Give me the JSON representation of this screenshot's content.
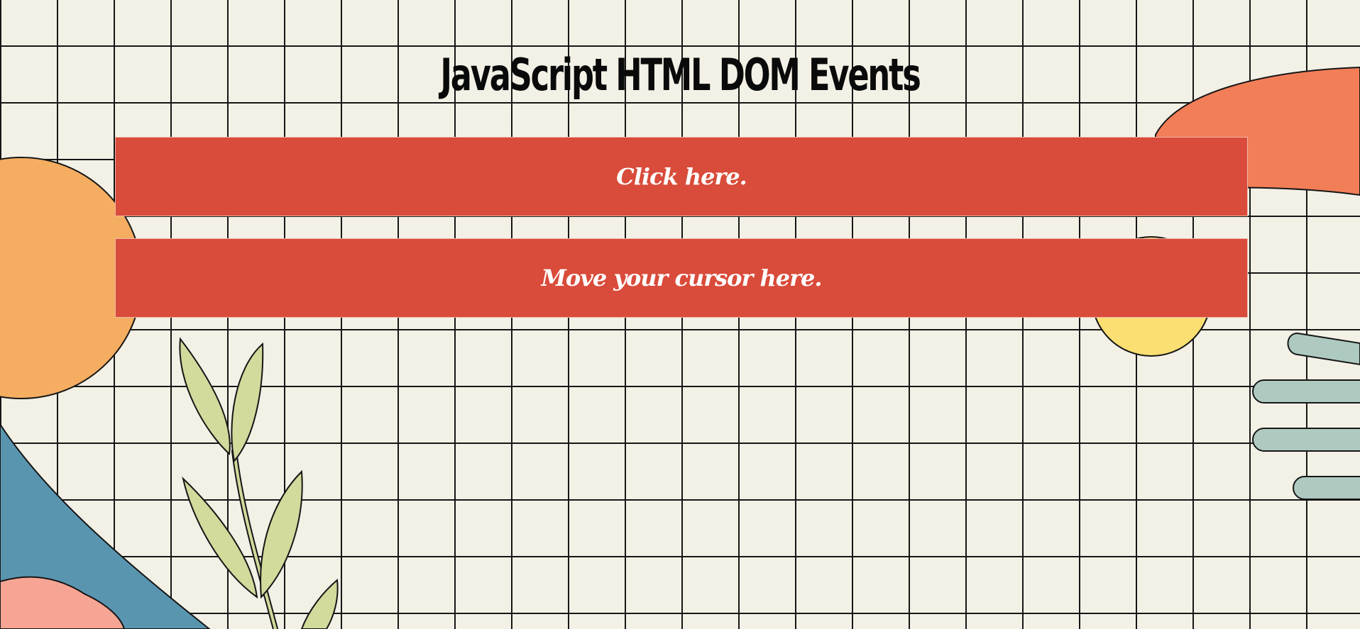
{
  "page": {
    "title": "JavaScript HTML DOM Events"
  },
  "boxes": {
    "click_label": "Click here.",
    "hover_label": "Move your cursor here."
  },
  "colors": {
    "background": "#f3f1e6",
    "grid_lines": "#161616",
    "box_fill": "#d94b3a",
    "box_text": "#ffffff",
    "title_text": "#0a0a0a",
    "deco_orange_circle": "#f5ad61",
    "deco_coral_shape": "#f27e58",
    "deco_yellow_circle": "#fbdf72",
    "deco_blue_shape": "#5a95b0",
    "deco_pink_shape": "#f6a595",
    "deco_leaves": "#d2da9c",
    "deco_sage_bars": "#aecac0"
  }
}
